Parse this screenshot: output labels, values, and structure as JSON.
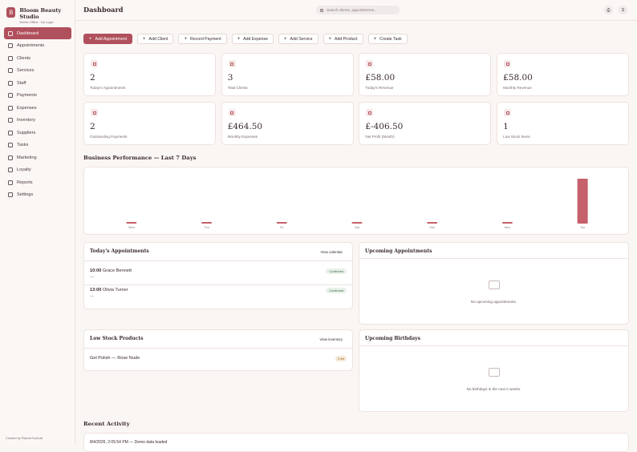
{
  "brand": {
    "name": "Bloom Beauty Studio",
    "subtitle": "Works Offline · No Login",
    "logo_letter": "B"
  },
  "sidebar": {
    "items": [
      {
        "label": "Dashboard",
        "icon": "dashboard-icon",
        "active": true
      },
      {
        "label": "Appointments",
        "icon": "calendar-icon"
      },
      {
        "label": "Clients",
        "icon": "users-icon"
      },
      {
        "label": "Services",
        "icon": "sparkle-icon"
      },
      {
        "label": "Staff",
        "icon": "staff-icon"
      },
      {
        "label": "Payments",
        "icon": "card-icon"
      },
      {
        "label": "Expenses",
        "icon": "dollar-icon"
      },
      {
        "label": "Inventory",
        "icon": "box-icon"
      },
      {
        "label": "Suppliers",
        "icon": "truck-icon"
      },
      {
        "label": "Tasks",
        "icon": "check-icon"
      },
      {
        "label": "Marketing",
        "icon": "megaphone-icon"
      },
      {
        "label": "Loyalty",
        "icon": "heart-icon"
      },
      {
        "label": "Reports",
        "icon": "report-icon"
      },
      {
        "label": "Settings",
        "icon": "gear-icon"
      }
    ],
    "credit": "Created by PlannerToolLab"
  },
  "header": {
    "title": "Dashboard",
    "search_placeholder": "Search clients, appointments...",
    "avatar_letter": "S"
  },
  "actions": [
    {
      "label": "Add Appointment",
      "primary": true
    },
    {
      "label": "Add Client"
    },
    {
      "label": "Record Payment"
    },
    {
      "label": "Add Expense"
    },
    {
      "label": "Add Service"
    },
    {
      "label": "Add Product"
    },
    {
      "label": "Create Task"
    }
  ],
  "stats": [
    {
      "value": "2",
      "label": "Today's Appointments",
      "icon": "calendar-icon"
    },
    {
      "value": "3",
      "label": "Total Clients",
      "icon": "users-icon"
    },
    {
      "value": "£58.00",
      "label": "Today's Revenue",
      "icon": "card-icon"
    },
    {
      "value": "£58.00",
      "label": "Monthly Revenue",
      "icon": "trend-icon"
    },
    {
      "value": "2",
      "label": "Outstanding Payments",
      "icon": "alert-icon"
    },
    {
      "value": "£464.50",
      "label": "Monthly Expenses",
      "icon": "dollar-icon"
    },
    {
      "value": "£-406.50",
      "label": "Net Profit (Month)",
      "icon": "clock-icon"
    },
    {
      "value": "1",
      "label": "Low Stock Items",
      "icon": "box-icon"
    }
  ],
  "performance": {
    "title": "Business Performance — Last 7 Days"
  },
  "chart_data": {
    "type": "bar",
    "categories": [
      "Wed",
      "Thu",
      "Fri",
      "Sat",
      "Sun",
      "Mon",
      "Tue"
    ],
    "values": [
      0,
      0,
      0,
      0,
      0,
      0,
      58
    ],
    "ylim": [
      0,
      58
    ],
    "color": "#c6606a",
    "grid": false
  },
  "today_appointments": {
    "title": "Today's Appointments",
    "link": "View calendar",
    "items": [
      {
        "time": "10:00",
        "client": "Grace Bennett",
        "detail": "—",
        "status": "Confirmed"
      },
      {
        "time": "13:00",
        "client": "Olivia Turner",
        "detail": "—",
        "status": "Confirmed"
      }
    ]
  },
  "upcoming_appointments": {
    "title": "Upcoming Appointments",
    "empty": "No upcoming appointments."
  },
  "low_stock": {
    "title": "Low Stock Products",
    "link": "View inventory",
    "items": [
      {
        "name": "Gel Polish — Rose Nude",
        "badge": "3 left"
      }
    ]
  },
  "upcoming_birthdays": {
    "title": "Upcoming Birthdays",
    "empty": "No birthdays in the next 2 weeks."
  },
  "recent_activity": {
    "title": "Recent Activity",
    "items": [
      {
        "text": "8/4/2026, 2:05:54 PM — Demo data loaded"
      }
    ]
  }
}
